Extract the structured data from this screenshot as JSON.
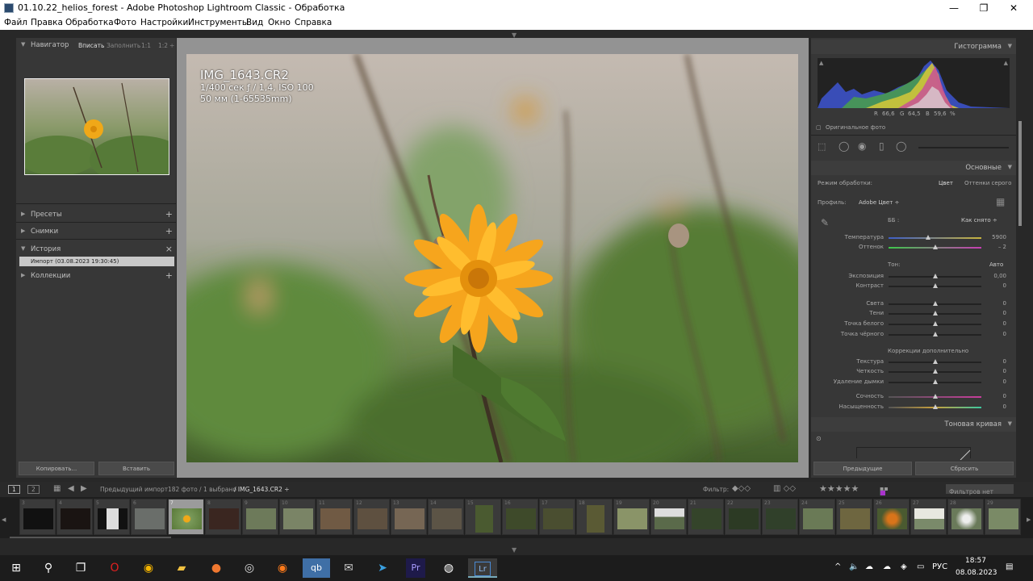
{
  "window": {
    "title": "01.10.22_helios_forest - Adobe Photoshop Lightroom Classic - Обработка",
    "minimize": "—",
    "maximize": "❐",
    "close": "✕"
  },
  "menu": [
    "Файл",
    "Правка",
    "Обработка",
    "Фото",
    "Настройки",
    "Инструменты",
    "Вид",
    "Окно",
    "Справка"
  ],
  "left": {
    "navigator": "Навигатор",
    "nav_opts": [
      "Вписать",
      "Заполнить",
      "1:1",
      "1:2"
    ],
    "presets": "Пресеты",
    "snapshots": "Снимки",
    "history": "История",
    "history_item": "Импорт (03.08.2023 19:30:45)",
    "collections": "Коллекции",
    "copy_btn": "Копировать...",
    "paste_btn": "Вставить"
  },
  "photo_info": {
    "name": "IMG_1643.CR2",
    "exposure": "1/400 сек   ƒ / 1,4, ISO 100",
    "lens": "50 мм (1-65535mm)"
  },
  "right": {
    "histogram": "Гистограмма",
    "r_label": "R",
    "r_val": "66,6",
    "g_label": "G",
    "g_val": "64,5",
    "b_label": "B",
    "b_val": "59,6",
    "pct": "%",
    "original": "Оригинальное фото",
    "basic": "Основные",
    "mode_label": "Режим обработки:",
    "mode_color": "Цвет",
    "mode_gray": "Оттенки серого",
    "profile_label": "Профиль:",
    "profile_val": "Adobe Цвет ÷",
    "wb_label": "ББ :",
    "wb_val": "Как снято ÷",
    "tone_label": "Тон:",
    "auto": "Авто",
    "presence": "Коррекции дополнительно",
    "tone_curve": "Тоновая кривая",
    "prev_btn": "Предыдущие",
    "reset_btn": "Сбросить",
    "sliders": [
      {
        "label": "Температура",
        "value": "5900",
        "pos": 0.45
      },
      {
        "label": "Оттенок",
        "value": "– 2",
        "pos": 0.5
      },
      {
        "label": "Экспозиция",
        "value": "0,00",
        "pos": 0.5
      },
      {
        "label": "Контраст",
        "value": "0",
        "pos": 0.5
      },
      {
        "label": "Света",
        "value": "0",
        "pos": 0.5
      },
      {
        "label": "Тени",
        "value": "0",
        "pos": 0.5
      },
      {
        "label": "Точка белого",
        "value": "0",
        "pos": 0.5
      },
      {
        "label": "Точка чёрного",
        "value": "0",
        "pos": 0.5
      },
      {
        "label": "Текстура",
        "value": "0",
        "pos": 0.5
      },
      {
        "label": "Четкость",
        "value": "0",
        "pos": 0.5
      },
      {
        "label": "Удаление дымки",
        "value": "0",
        "pos": 0.5
      },
      {
        "label": "Сочность",
        "value": "0",
        "pos": 0.5
      },
      {
        "label": "Насыщенность",
        "value": "0",
        "pos": 0.5
      }
    ]
  },
  "filmbar": {
    "source": "Предыдущий импорт",
    "count": "182 фото  / 1 выбрано",
    "file": "/ IMG_1643.CR2 ÷",
    "filter": "Фильтр:",
    "filter_val": "Фильтров нет"
  },
  "film_indices": [
    "3",
    "4",
    "5",
    "6",
    "7",
    "8",
    "9",
    "10",
    "11",
    "12",
    "13",
    "14",
    "15",
    "16",
    "17",
    "18",
    "19",
    "20",
    "21",
    "22",
    "23",
    "24",
    "25",
    "26",
    "27",
    "28",
    "29"
  ],
  "taskbar": {
    "lang": "РУС",
    "time": "18:57",
    "date": "08.08.2023",
    "tray_arrow": "^"
  }
}
